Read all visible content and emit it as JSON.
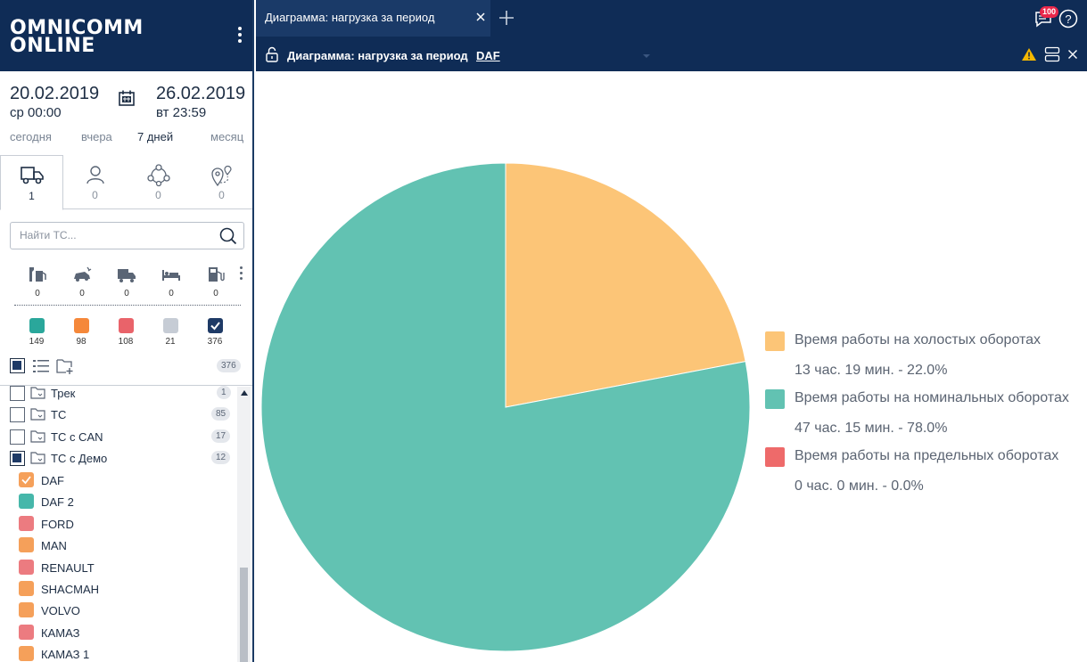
{
  "logo": {
    "line1": "OMNICOMM",
    "line2": "ONLINE"
  },
  "period": {
    "start_date": "20.02.2019",
    "start_time": "ср 00:00",
    "end_date": "26.02.2019",
    "end_time": "вт 23:59",
    "quick": [
      "сегодня",
      "вчера",
      "7 дней",
      "месяц"
    ],
    "quick_active": "7 дней"
  },
  "object_tabs": [
    {
      "icon": "truck-icon",
      "count": "1"
    },
    {
      "icon": "user-icon",
      "count": "0"
    },
    {
      "icon": "network-icon",
      "count": "0"
    },
    {
      "icon": "geozone-icon",
      "count": "0"
    }
  ],
  "search": {
    "placeholder": "Найти ТС..."
  },
  "filter_icons": [
    {
      "icon": "fuel-wrench-icon",
      "count": "0"
    },
    {
      "icon": "car-crash-icon",
      "count": "0"
    },
    {
      "icon": "truck-icon",
      "count": "0"
    },
    {
      "icon": "bed-icon",
      "count": "0"
    },
    {
      "icon": "fuel-pump-icon",
      "count": "0"
    }
  ],
  "status_filters": [
    {
      "color": "#2aa79b",
      "count": "149"
    },
    {
      "color": "#f5883a",
      "count": "98"
    },
    {
      "color": "#e9636a",
      "count": "108"
    },
    {
      "color": "#c6ccd5",
      "count": "21"
    },
    {
      "color": "#1e3a66",
      "count": "376",
      "checked": true
    }
  ],
  "list_toolbar": {
    "total": "376"
  },
  "groups": [
    {
      "name": "Трек",
      "count": "1",
      "checked": false
    },
    {
      "name": "ТС",
      "count": "85",
      "checked": false
    },
    {
      "name": "ТС с CAN",
      "count": "17",
      "checked": false
    },
    {
      "name": "ТС с Демо",
      "count": "12",
      "checked": true
    }
  ],
  "vehicles": [
    {
      "name": "DAF",
      "color": "#f5a05a",
      "checked": true
    },
    {
      "name": "DAF 2",
      "color": "#46b7aa"
    },
    {
      "name": "FORD",
      "color": "#ec7b80"
    },
    {
      "name": "MAN",
      "color": "#f5a05a"
    },
    {
      "name": "RENAULT",
      "color": "#ec7b80"
    },
    {
      "name": "SHACMAH",
      "color": "#f5a05a"
    },
    {
      "name": "VOLVO",
      "color": "#f5a05a"
    },
    {
      "name": "КАМАЗ",
      "color": "#ec7b80"
    },
    {
      "name": "КАМАЗ 1",
      "color": "#f5a05a"
    }
  ],
  "tab": {
    "label": "Диаграмма: нагрузка за период"
  },
  "messages_badge": "100",
  "report": {
    "title": "Диаграмма: нагрузка за период",
    "vehicle": "DAF"
  },
  "chart_data": {
    "type": "pie",
    "slices": [
      {
        "name": "Время работы на холостых оборотах",
        "value": 22.0,
        "label": "13 час. 19 мин. - 22.0%",
        "color": "#fcc577"
      },
      {
        "name": "Время работы на номинальных оборотах",
        "value": 78.0,
        "label": "47 час. 15 мин. - 78.0%",
        "color": "#62c2b2"
      },
      {
        "name": "Время работы на предельных оборотах",
        "value": 0.0,
        "label": "0 час. 0 мин. - 0.0%",
        "color": "#ee6a6a"
      }
    ],
    "legend_position": "right"
  }
}
